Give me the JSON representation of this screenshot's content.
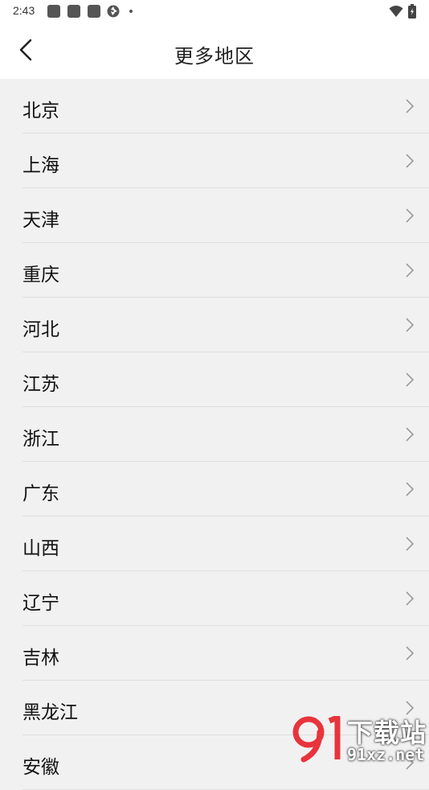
{
  "status_bar": {
    "time": "2:43",
    "notification_icons": [
      "app-icon",
      "app-icon",
      "app-icon",
      "aperture-icon"
    ],
    "right_icons": [
      "wifi-icon",
      "battery-icon"
    ]
  },
  "header": {
    "title": "更多地区",
    "back_icon": "chevron-left-icon"
  },
  "regions": [
    {
      "label": "北京"
    },
    {
      "label": "上海"
    },
    {
      "label": "天津"
    },
    {
      "label": "重庆"
    },
    {
      "label": "河北"
    },
    {
      "label": "江苏"
    },
    {
      "label": "浙江"
    },
    {
      "label": "广东"
    },
    {
      "label": "山西"
    },
    {
      "label": "辽宁"
    },
    {
      "label": "吉林"
    },
    {
      "label": "黑龙江"
    },
    {
      "label": "安徽"
    }
  ],
  "watermark": {
    "title": "下载站",
    "url": "91xz.net"
  },
  "colors": {
    "background": "#f1f1f1",
    "header": "#ffffff",
    "divider": "#dedede",
    "chevron": "#9a9a9a",
    "watermark_accent": "#e8343c"
  }
}
